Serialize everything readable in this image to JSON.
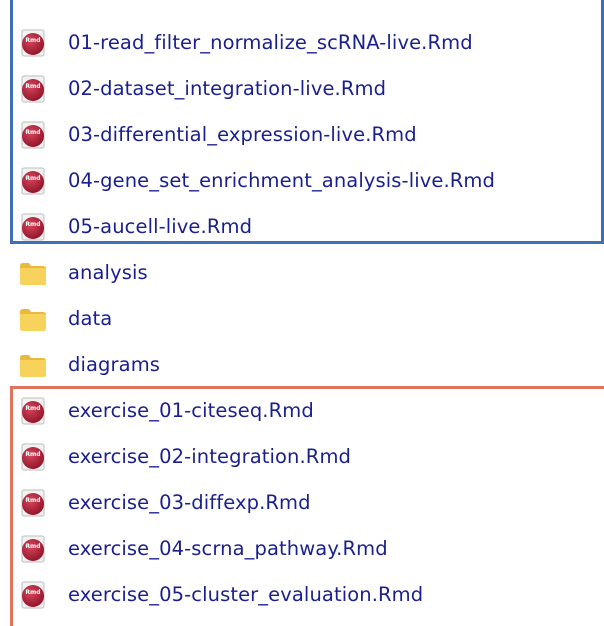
{
  "colors": {
    "filename_text": "#1a1f8e",
    "live_group_border": "#3e70b8",
    "exercise_group_border": "#e0735e",
    "rmd_icon_red": "#b01e35",
    "folder_yellow": "#f7d25c"
  },
  "files": [
    {
      "name": "01-read_filter_normalize_scRNA-live.Rmd",
      "icon": "rmd-file-icon",
      "badge": "Rmd"
    },
    {
      "name": "02-dataset_integration-live.Rmd",
      "icon": "rmd-file-icon",
      "badge": "Rmd"
    },
    {
      "name": "03-differential_expression-live.Rmd",
      "icon": "rmd-file-icon",
      "badge": "Rmd"
    },
    {
      "name": "04-gene_set_enrichment_analysis-live.Rmd",
      "icon": "rmd-file-icon",
      "badge": "Rmd"
    },
    {
      "name": "05-aucell-live.Rmd",
      "icon": "rmd-file-icon",
      "badge": "Rmd"
    },
    {
      "name": "analysis",
      "icon": "folder-icon"
    },
    {
      "name": "data",
      "icon": "folder-icon"
    },
    {
      "name": "diagrams",
      "icon": "folder-icon"
    },
    {
      "name": "exercise_01-citeseq.Rmd",
      "icon": "rmd-file-icon",
      "badge": "Rmd"
    },
    {
      "name": "exercise_02-integration.Rmd",
      "icon": "rmd-file-icon",
      "badge": "Rmd"
    },
    {
      "name": "exercise_03-diffexp.Rmd",
      "icon": "rmd-file-icon",
      "badge": "Rmd"
    },
    {
      "name": "exercise_04-scrna_pathway.Rmd",
      "icon": "rmd-file-icon",
      "badge": "Rmd"
    },
    {
      "name": "exercise_05-cluster_evaluation.Rmd",
      "icon": "rmd-file-icon",
      "badge": "Rmd"
    }
  ]
}
